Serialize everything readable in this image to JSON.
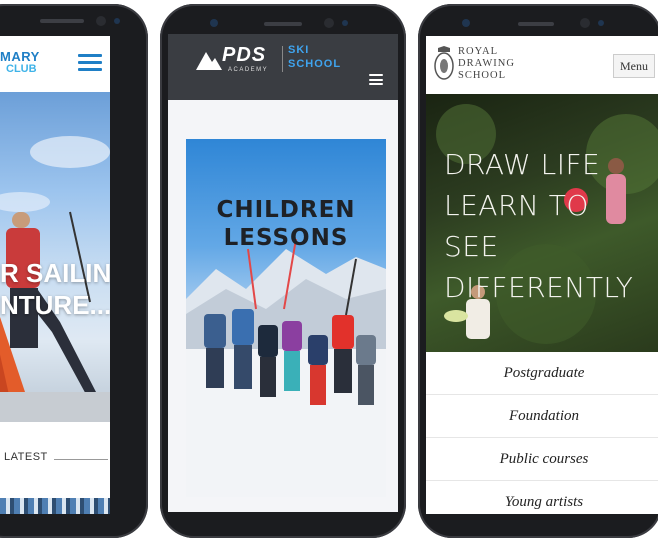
{
  "colors": {
    "club_blue": "#1f7fc6",
    "pds_blue": "#1b6fd4",
    "sky": "#8bb8e6",
    "royal_dark": "#242d1a"
  },
  "phone1": {
    "logo_line1": "MARY",
    "logo_line2": "CLUB",
    "hero_line1": "R SAILING",
    "hero_line2": "NTURE...",
    "latest_label": "LATEST",
    "menu_icon": "hamburger-icon"
  },
  "phone2": {
    "logo_main": "PDS",
    "logo_sub": "ACADEMY",
    "logo_ski": "SKI",
    "logo_school": "SCHOOL",
    "card_line1": "CHILDREN",
    "card_line2": "LESSONS",
    "menu_icon": "hamburger-icon"
  },
  "phone3": {
    "logo_line1": "ROYAL",
    "logo_line2": "DRAWING",
    "logo_line3": "SCHOOL",
    "menu_button": "Menu",
    "hero_line1": "DRAW LIFE",
    "hero_line2": "LEARN TO",
    "hero_line3": "SEE",
    "hero_line4": "DIFFERENTLY",
    "menu_items": [
      {
        "label": "Postgraduate"
      },
      {
        "label": "Foundation"
      },
      {
        "label": "Public courses"
      },
      {
        "label": "Young artists"
      }
    ]
  }
}
